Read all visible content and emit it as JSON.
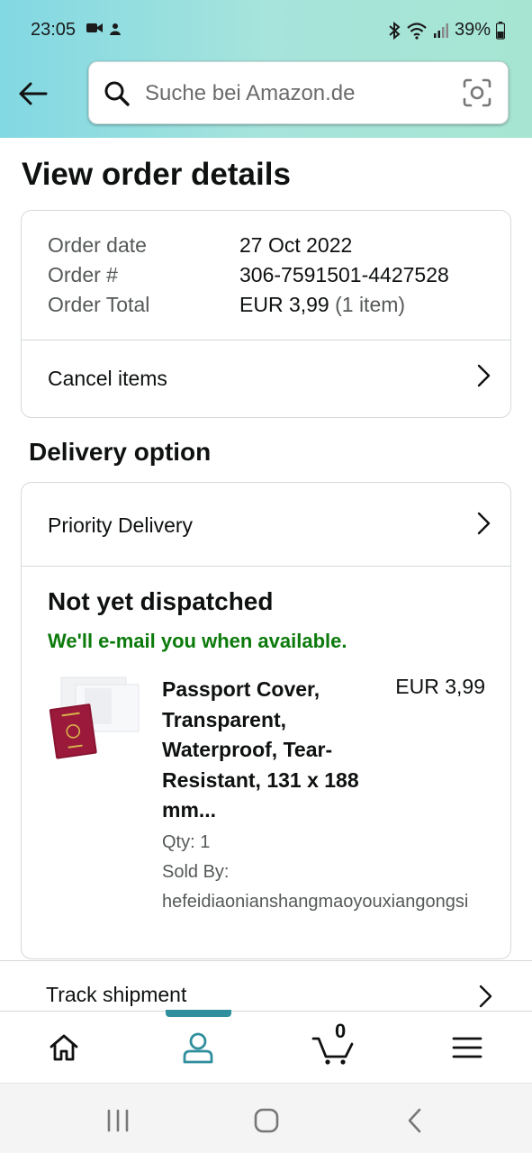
{
  "status": {
    "time": "23:05",
    "battery": "39%"
  },
  "search": {
    "placeholder": "Suche bei Amazon.de"
  },
  "page": {
    "title": "View order details"
  },
  "order": {
    "date_label": "Order date",
    "date_value": "27 Oct 2022",
    "number_label": "Order #",
    "number_value": "306-7591501-4427528",
    "total_label": "Order Total",
    "total_value": "EUR 3,99",
    "total_items": "(1 item)",
    "cancel_label": "Cancel items"
  },
  "delivery": {
    "section_title": "Delivery option",
    "option_label": "Priority Delivery",
    "status_title": "Not yet dispatched",
    "status_note": "We'll e-mail you when available."
  },
  "item": {
    "title": "Passport Cover, Transparent, Waterproof, Tear-Resistant, 131 x 188 mm...",
    "price": "EUR 3,99",
    "qty": "Qty: 1",
    "sold_by_label": "Sold By:",
    "seller": "hefeidiaonianshangmaoyouxiangongsi"
  },
  "track": {
    "label": "Track shipment"
  },
  "nav": {
    "cart_count": "0"
  },
  "colors": {
    "accent": "#2f8f9d",
    "status_green": "#0b7a0b",
    "border": "#d5d9d9"
  }
}
